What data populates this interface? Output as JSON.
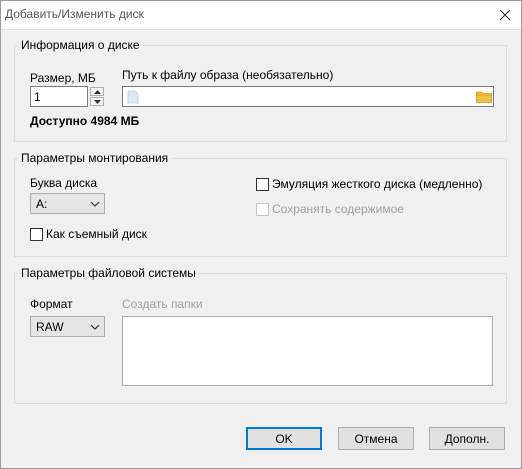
{
  "window": {
    "title": "Добавить/Изменить диск",
    "close_icon": "close-icon"
  },
  "disk_info": {
    "group_title": "Информация о диске",
    "size_label": "Размер, МБ",
    "size_value": "1",
    "path_label": "Путь к файлу образа (необязательно)",
    "path_value": "",
    "available_text": "Доступно 4984 МБ",
    "file_icon": "file-icon",
    "folder_icon": "folder-icon"
  },
  "mount": {
    "group_title": "Параметры монтирования",
    "drive_letter_label": "Буква диска",
    "drive_letter_value": "A:",
    "removable_label": "Как съемный диск",
    "removable_checked": false,
    "hdd_emulation_label": "Эмуляция жесткого диска (медленно)",
    "hdd_emulation_checked": false,
    "keep_contents_label": "Сохранять содержимое",
    "keep_contents_checked": false
  },
  "filesystem": {
    "group_title": "Параметры файловой системы",
    "format_label": "Формат",
    "format_value": "RAW",
    "create_folders_label": "Создать папки",
    "create_folders_value": ""
  },
  "buttons": {
    "ok": "OK",
    "cancel": "Отмена",
    "more": "Дополн."
  },
  "colors": {
    "accent": "#0078d7",
    "folder": "#f0c040"
  }
}
